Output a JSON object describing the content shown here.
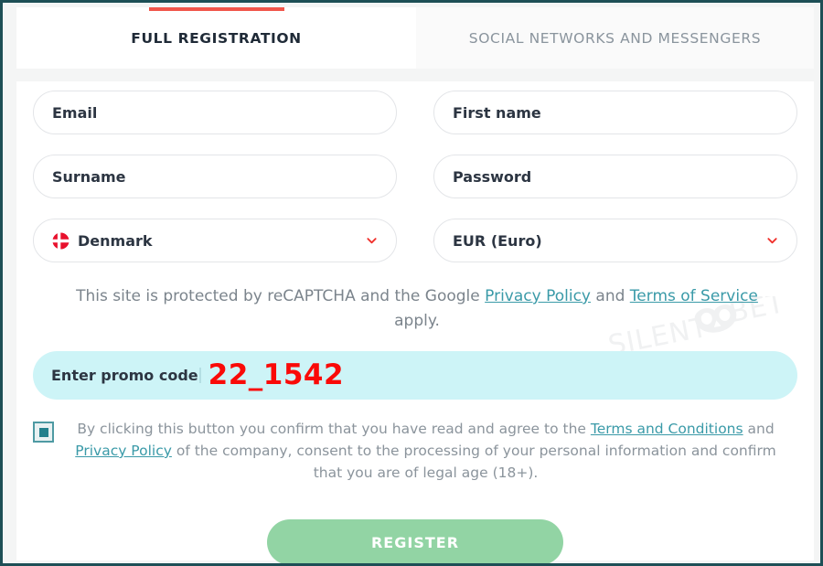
{
  "theme": {
    "frame_border": "#1d4f56",
    "accent_red": "#f1564a",
    "link_teal": "#3a9aa8",
    "promo_bg": "#cdf4f7",
    "promo_code_color": "#fa0a08",
    "register_green": "#92d4a4",
    "checkbox_teal": "#22808c"
  },
  "tabs": [
    {
      "label": "FULL REGISTRATION",
      "active": true
    },
    {
      "label": "SOCIAL NETWORKS AND MESSENGERS",
      "active": false
    }
  ],
  "form": {
    "fields": [
      {
        "name": "email",
        "label": "Email",
        "type": "text",
        "icon": null,
        "chevron": false
      },
      {
        "name": "first-name",
        "label": "First name",
        "type": "text",
        "icon": null,
        "chevron": false
      },
      {
        "name": "surname",
        "label": "Surname",
        "type": "text",
        "icon": null,
        "chevron": false
      },
      {
        "name": "password",
        "label": "Password",
        "type": "password",
        "icon": null,
        "chevron": false
      },
      {
        "name": "country",
        "label": "Denmark",
        "type": "select",
        "icon": "denmark-flag-icon",
        "chevron": true
      },
      {
        "name": "currency",
        "label": "EUR (Euro)",
        "type": "select",
        "icon": null,
        "chevron": true
      }
    ]
  },
  "recaptcha": {
    "text_before": "This site is protected by reCAPTCHA and the Google ",
    "privacy_policy": "Privacy Policy",
    "text_middle": " and ",
    "terms_of_service": "Terms of Service",
    "text_after": " apply."
  },
  "promo": {
    "label": "Enter promo code",
    "code": "22_1542"
  },
  "terms": {
    "checked": true,
    "part1": "By clicking this button you confirm that you have read and agree to the ",
    "link1": "Terms and Conditions",
    "part2": " and ",
    "link2": "Privacy Policy",
    "part3": " of the company, consent to the processing of your personal information and confirm that you are of legal age (18+)."
  },
  "register": {
    "label": "REGISTER"
  },
  "watermark": {
    "text": "SILENTBET",
    "logo": "owl-mask-icon"
  }
}
